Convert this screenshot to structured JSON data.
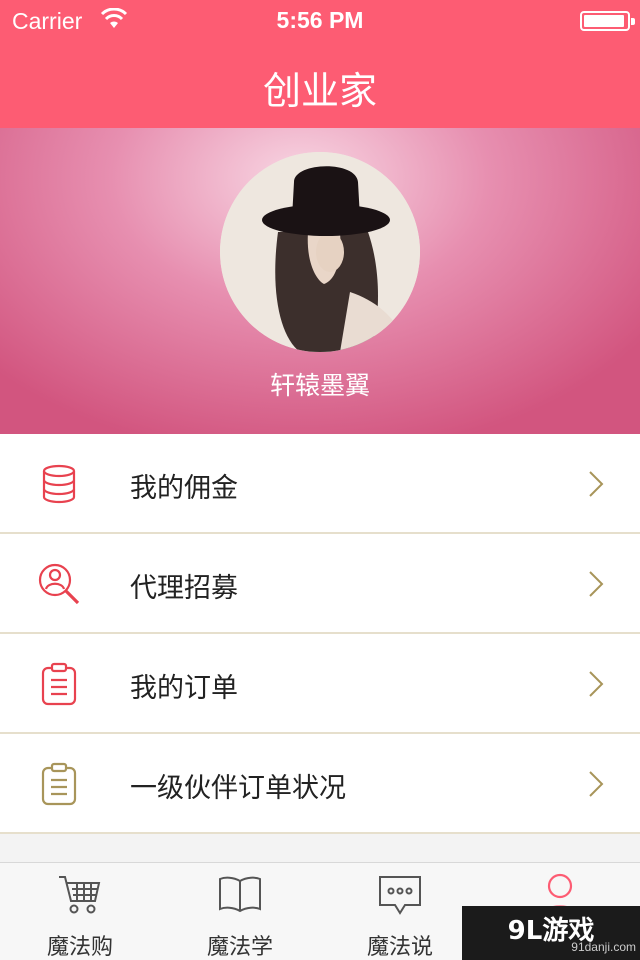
{
  "status_bar": {
    "carrier": "Carrier",
    "time": "5:56 PM"
  },
  "nav": {
    "title": "创业家"
  },
  "profile": {
    "username": "轩辕墨翼"
  },
  "menu": {
    "items": [
      {
        "label": "我的佣金",
        "icon": "database-icon"
      },
      {
        "label": "代理招募",
        "icon": "user-search-icon"
      },
      {
        "label": "我的订单",
        "icon": "clipboard-icon"
      },
      {
        "label": "一级伙伴订单状况",
        "icon": "clipboard-gold-icon"
      }
    ]
  },
  "tabs": [
    {
      "label": "魔法购",
      "icon": "cart-icon"
    },
    {
      "label": "魔法学",
      "icon": "book-icon"
    },
    {
      "label": "魔法说",
      "icon": "chat-icon"
    },
    {
      "label": "",
      "icon": "profile-icon",
      "active": true
    }
  ],
  "watermark": {
    "logo": "9L游戏",
    "url": "91danji.com"
  },
  "colors": {
    "primary": "#fd5c73",
    "icon_red": "#e8424f",
    "icon_gold": "#a8955a",
    "divider": "#e6dfcc"
  }
}
